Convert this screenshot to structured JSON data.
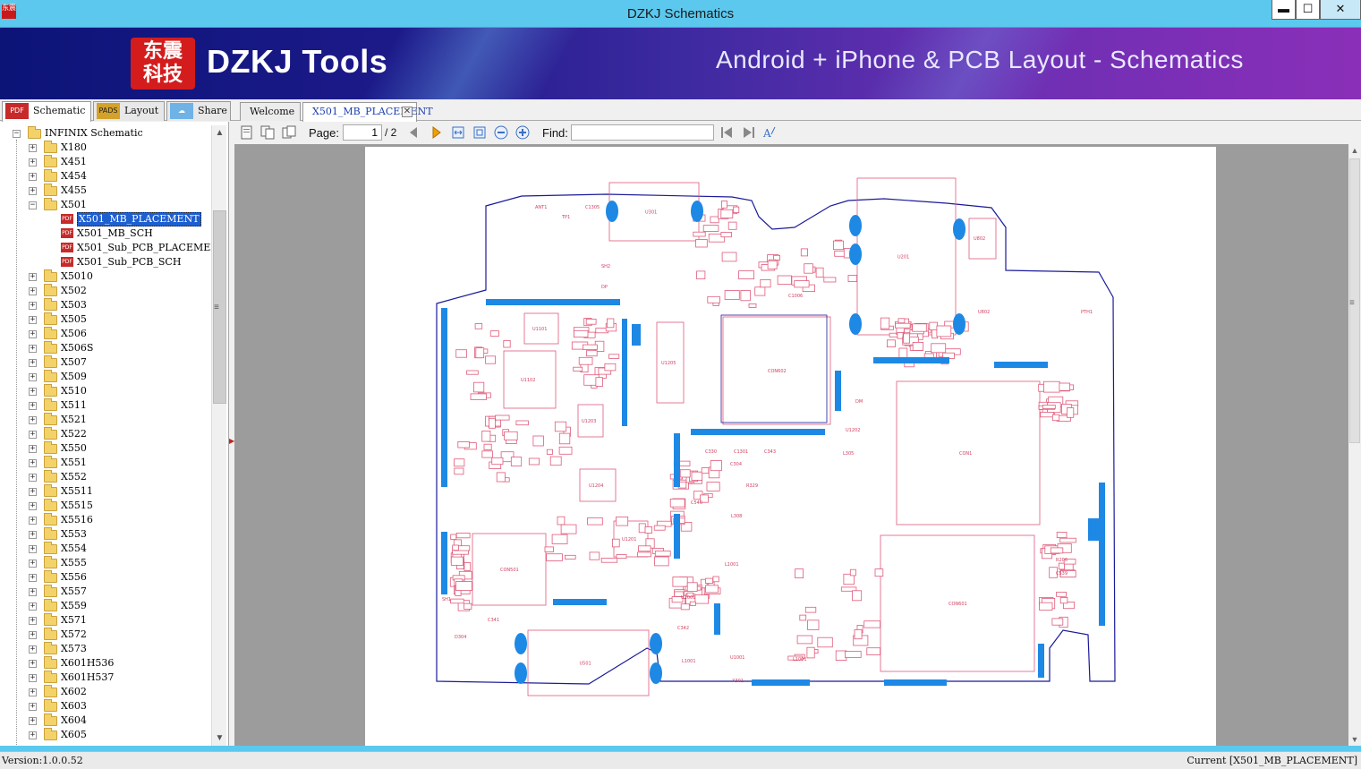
{
  "window": {
    "title": "DZKJ Schematics",
    "app_icon_text": "东震科技",
    "buttons": {
      "minimize": "▬",
      "maximize": "☐",
      "close": "✕"
    }
  },
  "banner": {
    "logo_text": "东震\n科技",
    "brand": "DZKJ Tools",
    "tagline": "Android + iPhone & PCB Layout - Schematics",
    "brand_color": "#d41c1c"
  },
  "left_tabs": [
    {
      "label": "Schematic",
      "icon": "pdf-icon",
      "icon_text": "PDF"
    },
    {
      "label": "Layout",
      "icon": "pads-icon",
      "icon_text": "PADS"
    },
    {
      "label": "Share",
      "icon": "cloud-share-icon",
      "icon_text": "☁"
    }
  ],
  "doc_tabs": [
    {
      "label": "Welcome"
    },
    {
      "label": "X501_MB_PLACEMENT",
      "active": true
    }
  ],
  "tree": {
    "root": "INFINIX Schematic",
    "items_before": [
      "X180",
      "X451",
      "X454",
      "X455"
    ],
    "expanded": "X501",
    "children": [
      "X501_MB_PLACEMENT",
      "X501_MB_SCH",
      "X501_Sub_PCB_PLACEMENT",
      "X501_Sub_PCB_SCH"
    ],
    "selected": "X501_MB_PLACEMENT",
    "items_after": [
      "X5010",
      "X502",
      "X503",
      "X505",
      "X506",
      "X506S",
      "X507",
      "X509",
      "X510",
      "X511",
      "X521",
      "X522",
      "X550",
      "X551",
      "X552",
      "X5511",
      "X5515",
      "X5516",
      "X553",
      "X554",
      "X555",
      "X556",
      "X557",
      "X559",
      "X571",
      "X572",
      "X573",
      "X601H536",
      "X601H537",
      "X602",
      "X603",
      "X604",
      "X605"
    ]
  },
  "toolbar": {
    "page_label": "Page:",
    "page_current": "1",
    "page_total": "/ 2",
    "find_label": "Find:",
    "find_value": ""
  },
  "pcb_labels": {
    "main": [
      "CON1",
      "CON602",
      "CON601",
      "CON501",
      "U1102",
      "U1101",
      "U1204",
      "U1201",
      "U1203",
      "U1205",
      "U301",
      "U201",
      "U501",
      "U802",
      "U1001",
      "L1001",
      "C341",
      "R308",
      "X301",
      "SH1",
      "SH2",
      "DP",
      "DM",
      "TP1",
      "ANT1",
      "C1305",
      "C1301",
      "C330",
      "C343",
      "C304",
      "R329",
      "L308",
      "L305",
      "D304",
      "U1202",
      "R206",
      "C539",
      "C540",
      "C342",
      "C1006",
      "R673"
    ]
  },
  "status": {
    "version": "Version:1.0.0.52",
    "current": "Current [X501_MB_PLACEMENT]"
  },
  "colors": {
    "title_bar": "#5cc8ed",
    "pcb_outline": "#1a1a9a",
    "pcb_component": "#e05a7a",
    "pcb_pad": "#1e88e5"
  }
}
